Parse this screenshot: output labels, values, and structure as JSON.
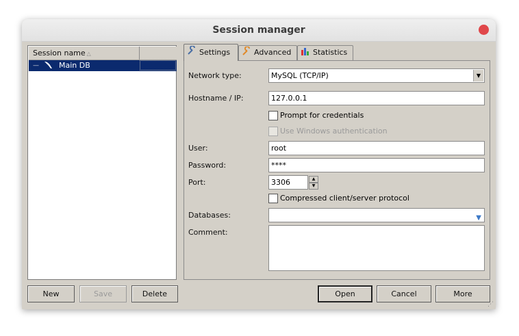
{
  "window": {
    "title": "Session manager"
  },
  "tree": {
    "column_header": "Session name",
    "sessions": [
      {
        "label": "Main DB",
        "selected": true
      }
    ]
  },
  "tabs": [
    {
      "label": "Settings",
      "icon": "wrench-icon",
      "active": true
    },
    {
      "label": "Advanced",
      "icon": "wrench-icon",
      "active": false
    },
    {
      "label": "Statistics",
      "icon": "bar-chart-icon",
      "active": false
    }
  ],
  "settings": {
    "network_type": {
      "label": "Network type:",
      "value": "MySQL (TCP/IP)"
    },
    "hostname": {
      "label": "Hostname / IP:",
      "value": "127.0.0.1"
    },
    "prompt_credentials": {
      "label": "Prompt for credentials",
      "checked": false
    },
    "windows_auth": {
      "label": "Use Windows authentication",
      "checked": false,
      "enabled": false
    },
    "user": {
      "label": "User:",
      "value": "root"
    },
    "password": {
      "label": "Password:",
      "value": "****"
    },
    "port": {
      "label": "Port:",
      "value": "3306"
    },
    "compressed": {
      "label": "Compressed client/server protocol",
      "checked": false
    },
    "databases": {
      "label": "Databases:",
      "value": ""
    },
    "comment": {
      "label": "Comment:",
      "value": ""
    }
  },
  "buttons": {
    "new": "New",
    "save": "Save",
    "delete": "Delete",
    "open": "Open",
    "cancel": "Cancel",
    "more": "More"
  },
  "colors": {
    "selection": "#0b2a6e",
    "window_bg": "#d4d0c8",
    "close": "#e0474a"
  }
}
